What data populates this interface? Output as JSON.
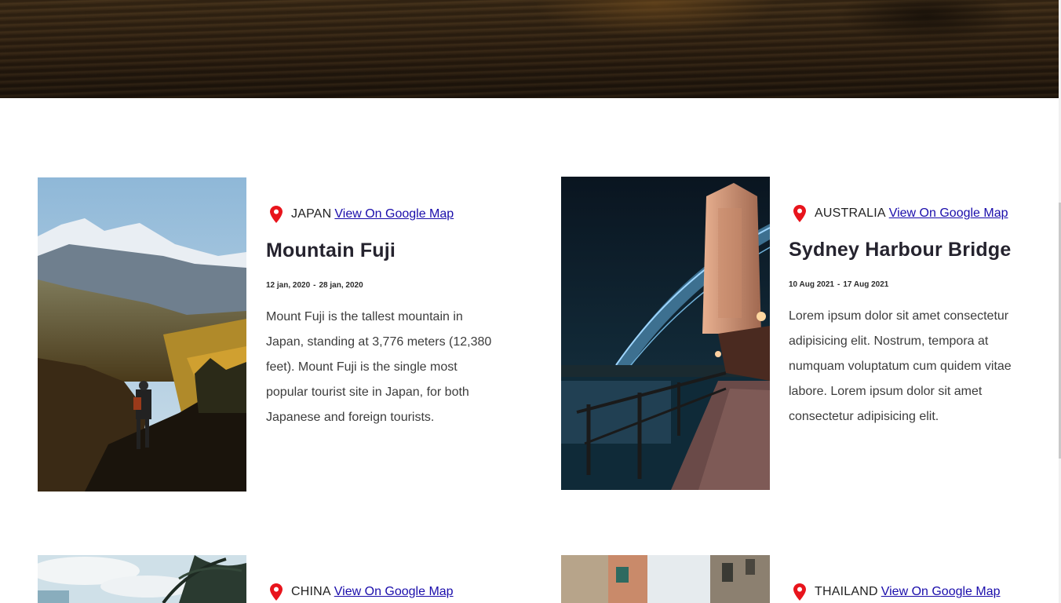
{
  "cards": [
    {
      "country": "JAPAN",
      "map_link": "View On Google Map",
      "title": "Mountain Fuji",
      "date_start": "12 jan, 2020",
      "date_end": "28 jan, 2020",
      "date_sep": "-",
      "description": "Mount Fuji is the tallest mountain in Japan, standing at 3,776 meters (12,380 feet). Mount Fuji is the single most popular tourist site in Japan, for both Japanese and foreign tourists.",
      "image_icon": "mountain-hiker-photo"
    },
    {
      "country": "AUSTRALIA",
      "map_link": "View On Google Map",
      "title": "Sydney Harbour Bridge",
      "date_start": "10 Aug 2021",
      "date_end": "17 Aug 2021",
      "date_sep": "-",
      "description": "Lorem ipsum dolor sit amet consectetur adipisicing elit. Nostrum, tempora at numquam voluptatum cum quidem vitae labore. Lorem ipsum dolor sit amet consectetur adipisicing elit.",
      "image_icon": "bridge-night-photo"
    },
    {
      "country": "CHINA",
      "map_link": "View On Google Map",
      "image_icon": "palm-tree-photo"
    },
    {
      "country": "THAILAND",
      "map_link": "View On Google Map",
      "image_icon": "old-street-photo"
    }
  ],
  "colors": {
    "pin": "#e8141c",
    "link": "#1a0dab",
    "title": "#25232e"
  }
}
